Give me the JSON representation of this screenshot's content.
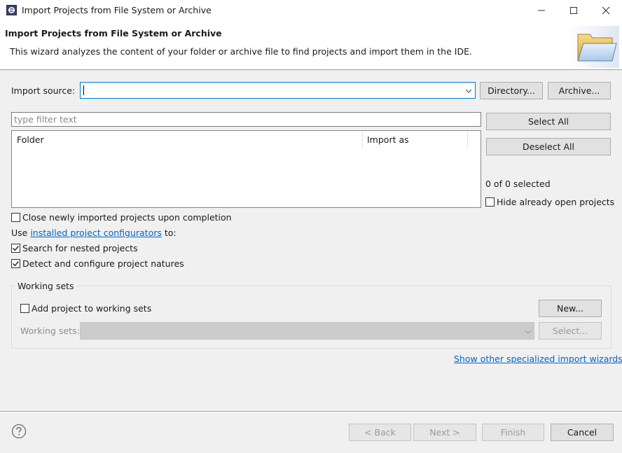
{
  "window": {
    "title": "Import Projects from File System or Archive"
  },
  "banner": {
    "title": "Import Projects from File System or Archive",
    "description": "This wizard analyzes the content of your folder or archive file to find projects and import them in the IDE."
  },
  "import_source": {
    "label": "Import source:",
    "value": "",
    "directory_button": "Directory...",
    "archive_button": "Archive..."
  },
  "filter": {
    "placeholder": "type filter text"
  },
  "table": {
    "columns": [
      "Folder",
      "Import as"
    ],
    "rows": []
  },
  "selection": {
    "select_all": "Select All",
    "deselect_all": "Deselect All",
    "count_text": "0 of 0 selected",
    "hide_open_label": "Hide already open projects",
    "hide_open_checked": false
  },
  "options": {
    "close_after_import": {
      "label": "Close newly imported projects upon completion",
      "checked": false
    },
    "configurators_prefix": "Use ",
    "configurators_link": "installed project configurators",
    "configurators_suffix": " to:",
    "search_nested": {
      "label": "Search for nested projects",
      "checked": true
    },
    "detect_natures": {
      "label": "Detect and configure project natures",
      "checked": true
    }
  },
  "working_sets": {
    "group_title": "Working sets",
    "add_label": "Add project to working sets",
    "add_checked": false,
    "new_button": "New...",
    "sets_label": "Working sets:",
    "select_button": "Select..."
  },
  "other_wizards_link": "Show other specialized import wizards",
  "footer": {
    "back": "< Back",
    "next": "Next >",
    "finish": "Finish",
    "cancel": "Cancel"
  },
  "icons": {
    "app": "eclipse-app-icon",
    "help": "help-icon",
    "banner": "open-folder-icon"
  }
}
